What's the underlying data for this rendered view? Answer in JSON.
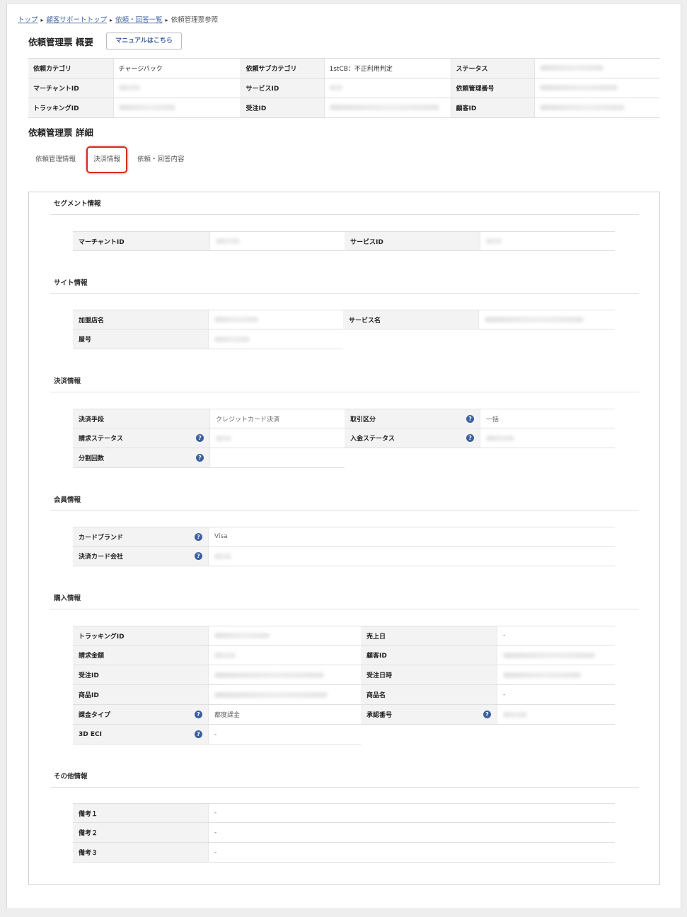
{
  "breadcrumb": {
    "items": [
      "トップ",
      "顧客サポートトップ",
      "依頼・回答一覧"
    ],
    "current": "依頼管理票参照"
  },
  "summary": {
    "title": "依頼管理票 概要",
    "manual_button": "マニュアルはこちら",
    "rows": [
      [
        {
          "label": "依頼カテゴリ",
          "value": "チャージバック"
        },
        {
          "label": "依頼サブカテゴリ",
          "value": "1stCB：不正利用判定"
        },
        {
          "label": "ステータス",
          "value": ""
        }
      ],
      [
        {
          "label": "マーチャントID",
          "value": ""
        },
        {
          "label": "サービスID",
          "value": ""
        },
        {
          "label": "依頼管理番号",
          "value": ""
        }
      ],
      [
        {
          "label": "トラッキングID",
          "value": ""
        },
        {
          "label": "受注ID",
          "value": ""
        },
        {
          "label": "顧客ID",
          "value": ""
        }
      ]
    ]
  },
  "detail": {
    "title": "依頼管理票 詳細",
    "tabs": [
      "依頼管理情報",
      "決済情報",
      "依頼・回答内容"
    ],
    "active_tab": "決済情報",
    "groups": {
      "segment": {
        "title": "セグメント情報",
        "labels": [
          "マーチャントID",
          "サービスID"
        ]
      },
      "site": {
        "title": "サイト情報",
        "labels": [
          "加盟店名",
          "サービス名",
          "屋号"
        ]
      },
      "payment": {
        "title": "決済情報",
        "labels": [
          "決済手段",
          "取引区分",
          "請求ステータス",
          "入金ステータス",
          "分割回数"
        ],
        "values": {
          "method": "クレジットカード決済",
          "transaction_type": "一括"
        }
      },
      "member": {
        "title": "会員情報",
        "labels": [
          "カードブランド",
          "決済カード会社"
        ],
        "values": {
          "brand": "Visa"
        }
      },
      "purchase": {
        "title": "購入情報",
        "labels": [
          "トラッキングID",
          "売上日",
          "請求金額",
          "顧客ID",
          "受注ID",
          "受注日時",
          "商品ID",
          "商品名",
          "課金タイプ",
          "承認番号",
          "3D ECI"
        ],
        "values": {
          "sales_date": "-",
          "product_name": "-",
          "charge_type": "都度課金",
          "eci": "-"
        }
      },
      "other": {
        "title": "その他情報",
        "labels": [
          "備考１",
          "備考２",
          "備考３"
        ],
        "values": [
          "-",
          "-",
          "-"
        ]
      }
    }
  },
  "help_icon": "?",
  "colors": {
    "accent": "#3c5f9e",
    "highlight": "#d9281f",
    "link": "#4a6aa5"
  }
}
